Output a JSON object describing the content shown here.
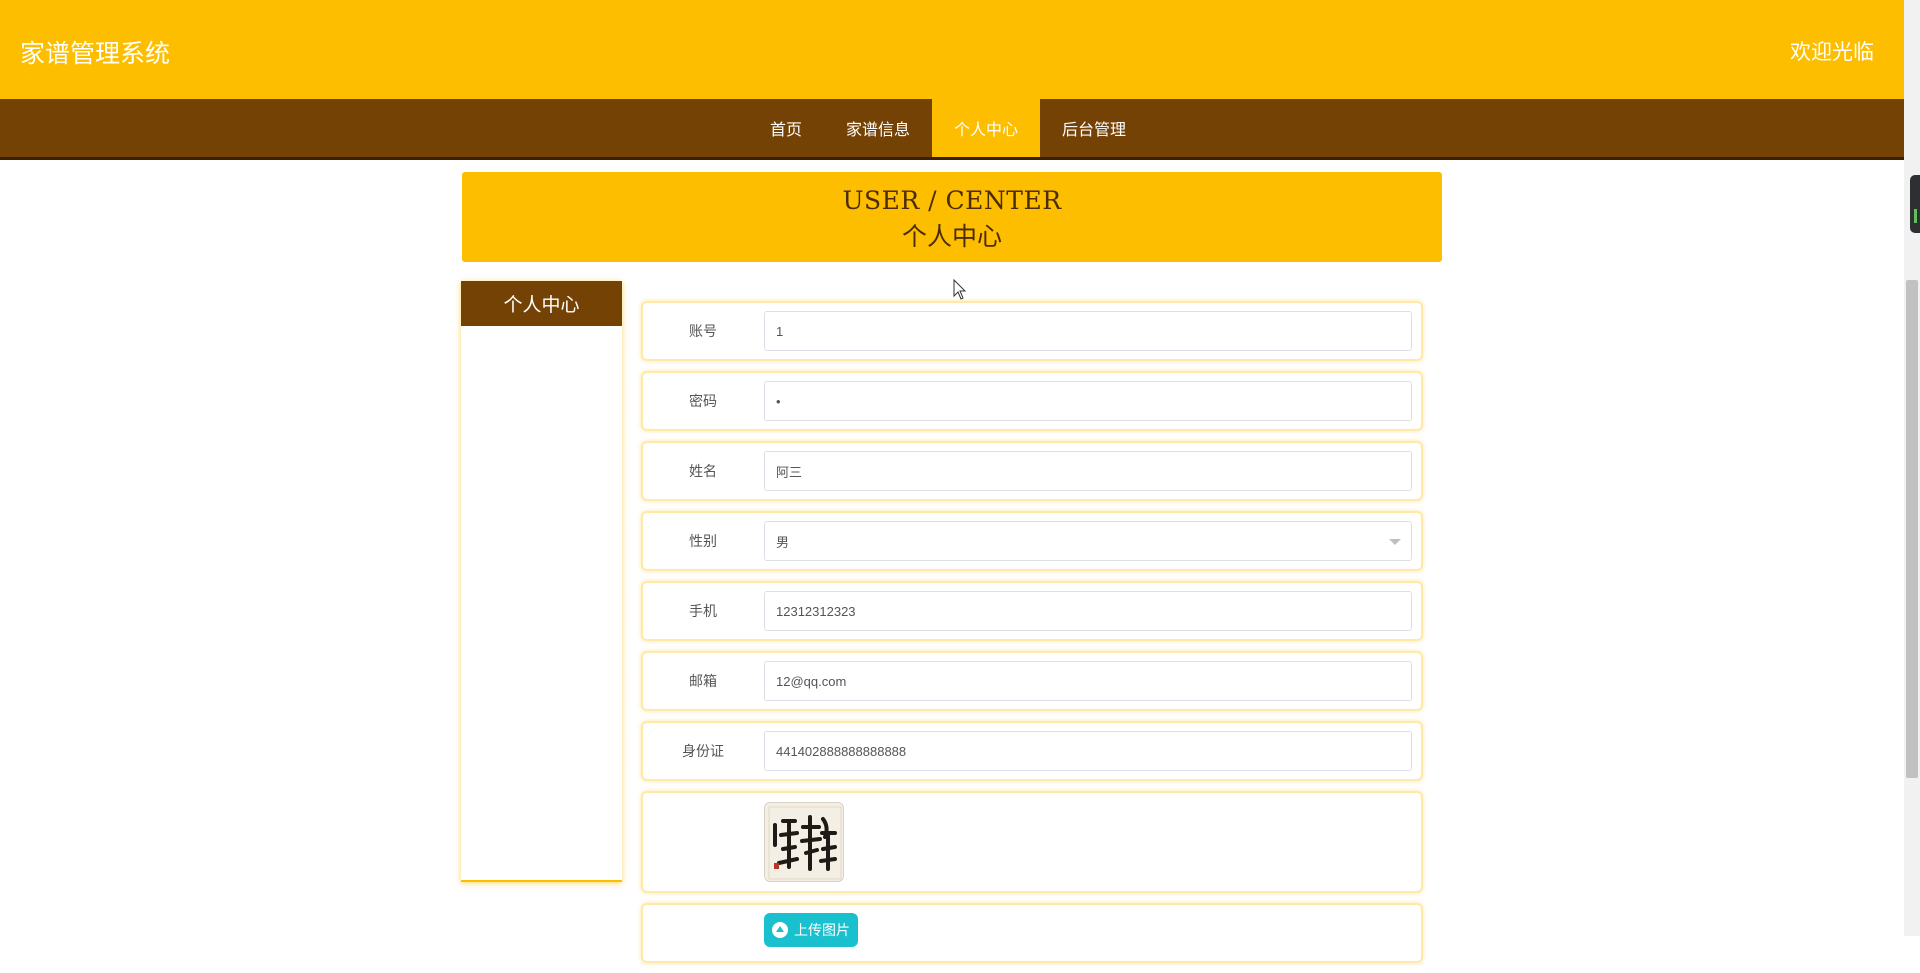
{
  "header": {
    "site_title": "家谱管理系统",
    "welcome": "欢迎光临"
  },
  "nav": {
    "items": [
      {
        "label": "首页"
      },
      {
        "label": "家谱信息"
      },
      {
        "label": "个人中心",
        "active": true
      },
      {
        "label": "后台管理"
      }
    ]
  },
  "banner": {
    "english": "USER / CENTER",
    "chinese": "个人中心"
  },
  "sidebar": {
    "title": "个人中心"
  },
  "form": {
    "account": {
      "label": "账号",
      "value": "1"
    },
    "password": {
      "label": "密码",
      "value": "•"
    },
    "name": {
      "label": "姓名",
      "value": "阿三"
    },
    "gender": {
      "label": "性别",
      "value": "男"
    },
    "phone": {
      "label": "手机",
      "value": "12312312323"
    },
    "email": {
      "label": "邮箱",
      "value": "12@qq.com"
    },
    "id_card": {
      "label": "身份证",
      "value": "441402888888888888"
    },
    "photo": {
      "seal_text": "拼搏"
    },
    "upload_label": "上传图片"
  },
  "colors": {
    "brand_yellow": "#fdbe00",
    "brand_brown": "#754205",
    "upload_teal": "#19c1cf"
  }
}
